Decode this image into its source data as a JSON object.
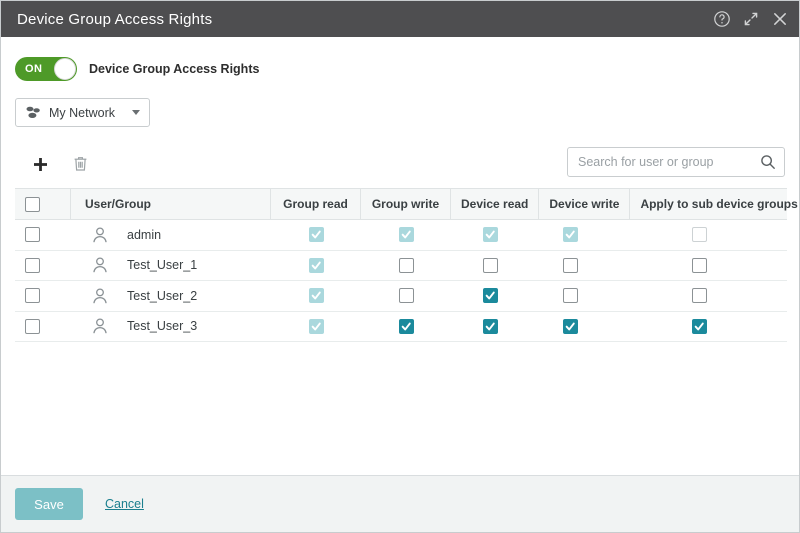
{
  "window": {
    "title": "Device Group Access Rights",
    "actions": [
      {
        "name": "help-icon",
        "label": "?"
      },
      {
        "name": "maximize-icon",
        "label": "Expand"
      },
      {
        "name": "close-icon",
        "label": "Close"
      }
    ]
  },
  "toggle": {
    "state_label": "ON",
    "caption": "Device Group Access Rights",
    "on": true,
    "on_color": "#4e9a28"
  },
  "network_selector": {
    "label": "My Network",
    "icon": "device-group-icon"
  },
  "toolbar": {
    "add_label": "+",
    "delete_label": "Delete"
  },
  "search": {
    "placeholder": "Search for user or group",
    "value": "",
    "icon": "search-icon"
  },
  "table": {
    "columns": [
      "User/Group",
      "Group read",
      "Group write",
      "Device read",
      "Device write",
      "Apply to sub device groups"
    ],
    "select_all": false,
    "rows": [
      {
        "selected": false,
        "name": "admin",
        "group_read": {
          "checked": true,
          "disabled": true
        },
        "group_write": {
          "checked": true,
          "disabled": true
        },
        "device_read": {
          "checked": true,
          "disabled": true
        },
        "device_write": {
          "checked": true,
          "disabled": true
        },
        "apply_sub": {
          "checked": false,
          "disabled": true
        }
      },
      {
        "selected": false,
        "name": "Test_User_1",
        "group_read": {
          "checked": true,
          "disabled": true
        },
        "group_write": {
          "checked": false,
          "disabled": false
        },
        "device_read": {
          "checked": false,
          "disabled": false
        },
        "device_write": {
          "checked": false,
          "disabled": false
        },
        "apply_sub": {
          "checked": false,
          "disabled": false
        }
      },
      {
        "selected": false,
        "name": "Test_User_2",
        "group_read": {
          "checked": true,
          "disabled": true
        },
        "group_write": {
          "checked": false,
          "disabled": false
        },
        "device_read": {
          "checked": true,
          "disabled": false
        },
        "device_write": {
          "checked": false,
          "disabled": false
        },
        "apply_sub": {
          "checked": false,
          "disabled": false
        }
      },
      {
        "selected": false,
        "name": "Test_User_3",
        "group_read": {
          "checked": true,
          "disabled": true
        },
        "group_write": {
          "checked": true,
          "disabled": false
        },
        "device_read": {
          "checked": true,
          "disabled": false
        },
        "device_write": {
          "checked": true,
          "disabled": false
        },
        "apply_sub": {
          "checked": true,
          "disabled": false
        }
      }
    ]
  },
  "footer": {
    "save_label": "Save",
    "cancel_label": "Cancel"
  },
  "colors": {
    "titlebar": "#4e4e50",
    "accent_teal": "#1b8a9c",
    "accent_teal_disabled": "#aad8dd",
    "toggle_green": "#4e9a28",
    "save_button": "#7cc0c6",
    "link": "#1b7f8e"
  }
}
